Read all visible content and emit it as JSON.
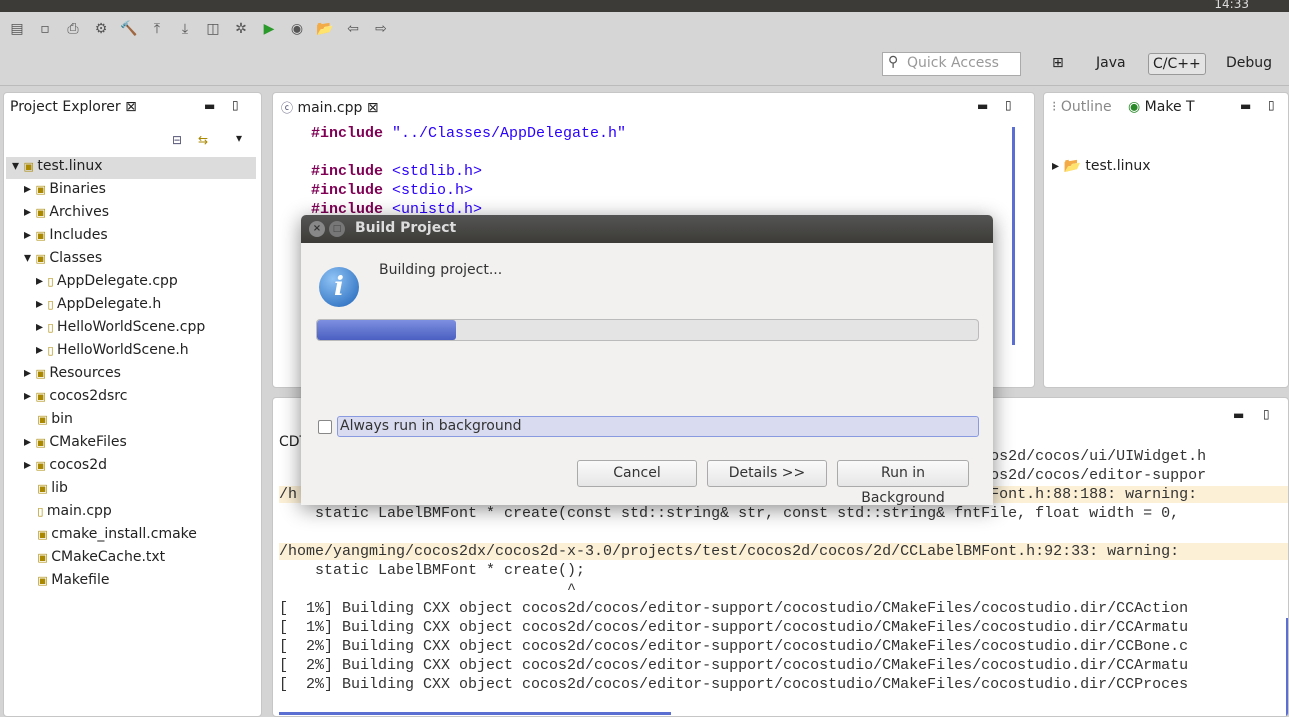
{
  "system": {
    "clock": "14:33"
  },
  "quick_access": {
    "placeholder": "Quick Access"
  },
  "perspectives": [
    "Java",
    "C/C++",
    "Debug"
  ],
  "explorer": {
    "title": "Project Explorer",
    "items": [
      {
        "label": "test.linux",
        "level": 0,
        "icon": "project-icon"
      },
      {
        "label": "Binaries",
        "level": 1
      },
      {
        "label": "Archives",
        "level": 1
      },
      {
        "label": "Includes",
        "level": 1
      },
      {
        "label": "Classes",
        "level": 1
      },
      {
        "label": "AppDelegate.cpp",
        "level": 2
      },
      {
        "label": "AppDelegate.h",
        "level": 2
      },
      {
        "label": "HelloWorldScene.cpp",
        "level": 2
      },
      {
        "label": "HelloWorldScene.h",
        "level": 2
      },
      {
        "label": "Resources",
        "level": 1
      },
      {
        "label": "cocos2dsrc",
        "level": 1
      },
      {
        "label": "bin",
        "level": 1
      },
      {
        "label": "CMakeFiles",
        "level": 1
      },
      {
        "label": "cocos2d",
        "level": 1
      },
      {
        "label": "lib",
        "level": 1
      },
      {
        "label": "main.cpp",
        "level": 1
      },
      {
        "label": "cmake_install.cmake",
        "level": 1
      },
      {
        "label": "CMakeCache.txt",
        "level": 1
      },
      {
        "label": "Makefile",
        "level": 1
      }
    ]
  },
  "editor": {
    "tab": "main.cpp",
    "lines": [
      {
        "kw": "#include",
        "arg": " \"../Classes/AppDelegate.h\""
      },
      {
        "kw": "",
        "arg": ""
      },
      {
        "kw": "#include",
        "arg": " <stdlib.h>"
      },
      {
        "kw": "#include",
        "arg": " <stdio.h>"
      },
      {
        "kw": "#include",
        "arg": " <unistd.h>"
      }
    ]
  },
  "right_panel": {
    "tabs": [
      "Outline",
      "Make T"
    ],
    "tree": [
      "test.linux"
    ]
  },
  "console": {
    "tab": "CDT",
    "lines": [
      {
        "text": "                                                                         st/cocos2d/cocos/ui/UIWidget.h",
        "warn": false
      },
      {
        "text": "                                                                         st/cocos2d/cocos/editor-suppor",
        "warn": false
      },
      {
        "text": "/h                                                                      LabelBMFont.h:88:188: warning:",
        "warn": true
      },
      {
        "text": "    static LabelBMFont * create(const std::string& str, const std::string& fntFile, float width = 0,",
        "warn": false
      },
      {
        "text": "",
        "warn": false
      },
      {
        "text": "/home/yangming/cocos2dx/cocos2d-x-3.0/projects/test/cocos2d/cocos/2d/CCLabelBMFont.h:92:33: warning:",
        "warn": true
      },
      {
        "text": "    static LabelBMFont * create();",
        "warn": false
      },
      {
        "text": "                                ^",
        "warn": false
      },
      {
        "text": "[  1%] Building CXX object cocos2d/cocos/editor-support/cocostudio/CMakeFiles/cocostudio.dir/CCAction",
        "warn": false
      },
      {
        "text": "[  1%] Building CXX object cocos2d/cocos/editor-support/cocostudio/CMakeFiles/cocostudio.dir/CCArmatu",
        "warn": false
      },
      {
        "text": "[  2%] Building CXX object cocos2d/cocos/editor-support/cocostudio/CMakeFiles/cocostudio.dir/CCBone.c",
        "warn": false
      },
      {
        "text": "[  2%] Building CXX object cocos2d/cocos/editor-support/cocostudio/CMakeFiles/cocostudio.dir/CCArmatu",
        "warn": false
      },
      {
        "text": "[  2%] Building CXX object cocos2d/cocos/editor-support/cocostudio/CMakeFiles/cocostudio.dir/CCProces",
        "warn": false
      }
    ]
  },
  "dialog": {
    "title": "Build Project",
    "message": "Building project...",
    "progress": 0.21,
    "checkbox_label": "Always run in background",
    "checked": false,
    "cancel": "Cancel",
    "details": "Details >>",
    "run_bg": "Run in Background"
  },
  "colors": {
    "progress": "#4a5fc1",
    "accent": "#5a6fd1"
  }
}
